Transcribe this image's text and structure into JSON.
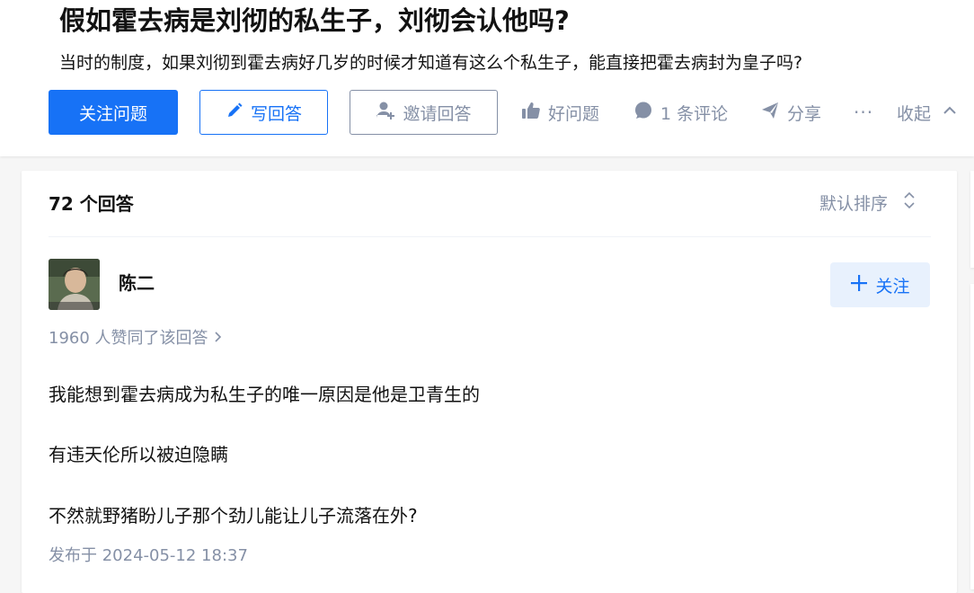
{
  "question": {
    "title": "假如霍去病是刘彻的私生子，刘彻会认他吗?",
    "detail": "当时的制度，如果刘彻到霍去病好几岁的时候才知道有这么个私生子，能直接把霍去病封为皇子吗?"
  },
  "actions": {
    "follow_label": "关注问题",
    "write_label": "写回答",
    "invite_label": "邀请回答",
    "like_label": "好问题",
    "comment_label": "1 条评论",
    "share_label": "分享",
    "more_label": "···",
    "collapse_label": "收起"
  },
  "answers": {
    "count_label": "72 个回答",
    "sort_label": "默认排序"
  },
  "answer": {
    "author_name": "陈二",
    "follow_label": "关注",
    "voters_label": "1960 人赞同了该回答",
    "paragraphs": [
      "我能想到霍去病成为私生子的唯一原因是他是卫青生的",
      "有违天伦所以被迫隐瞒",
      "不然就野猪盼儿子那个劲儿能让儿子流落在外?"
    ],
    "published": "发布于 2024-05-12 18:37"
  },
  "colors": {
    "brand_blue": "#1772f6",
    "muted_gray": "#8590a6",
    "text": "#121212"
  }
}
